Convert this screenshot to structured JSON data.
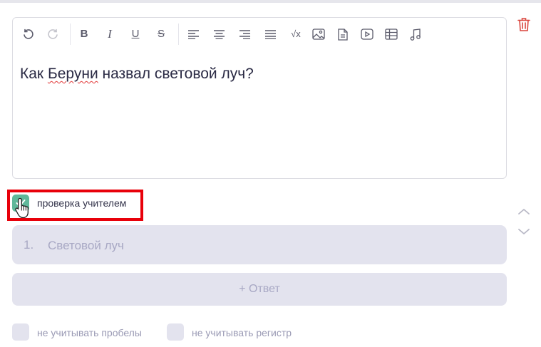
{
  "toolbar": {
    "buttons": [
      {
        "name": "undo-icon",
        "enabled": true
      },
      {
        "name": "redo-icon",
        "enabled": false
      },
      {
        "name": "bold-icon",
        "glyph": "B"
      },
      {
        "name": "italic-icon",
        "glyph": "I"
      },
      {
        "name": "underline-icon",
        "glyph": "U"
      },
      {
        "name": "strikethrough-icon",
        "glyph": "S"
      },
      {
        "name": "align-left-icon"
      },
      {
        "name": "align-center-icon"
      },
      {
        "name": "align-right-icon"
      },
      {
        "name": "align-justify-icon"
      },
      {
        "name": "formula-icon",
        "glyph": "√x"
      },
      {
        "name": "image-icon"
      },
      {
        "name": "file-icon"
      },
      {
        "name": "video-icon"
      },
      {
        "name": "table-icon"
      },
      {
        "name": "music-icon"
      }
    ]
  },
  "editor": {
    "question_before": "Как ",
    "question_misspelled": "Беруни",
    "question_after": " назвал световой луч?"
  },
  "teacher_check": {
    "label": "проверка учителем",
    "checked": true
  },
  "answers": [
    {
      "number": "1.",
      "placeholder": "Световой луч",
      "value": ""
    }
  ],
  "add_answer_label": "+ Ответ",
  "options": {
    "ignore_spaces_label": "не учитывать пробелы",
    "ignore_spaces_checked": false,
    "ignore_case_label": "не учитывать регистр",
    "ignore_case_checked": false
  },
  "colors": {
    "accent_check": "#5fb89a",
    "highlight_border": "#e8000a",
    "trash": "#d9443c",
    "field_bg": "#e3e3ee"
  }
}
